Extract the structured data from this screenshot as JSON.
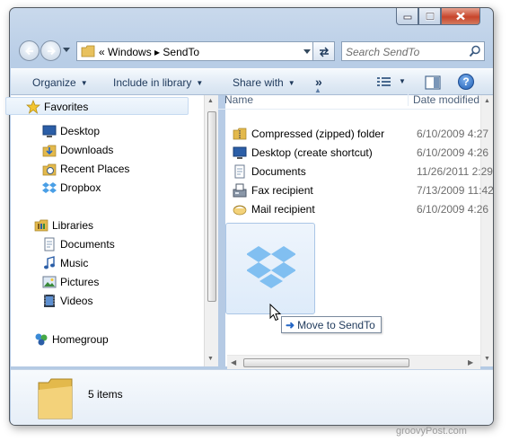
{
  "window": {
    "controls": {
      "minimize": "minimize-icon",
      "maximize": "maximize-icon",
      "close": "close-icon"
    }
  },
  "address_bar": {
    "back_icon": "back-arrow-icon",
    "forward_icon": "forward-arrow-icon",
    "chevrons": "«",
    "crumbs": "Windows ▸ SendTo",
    "refresh_icon": "refresh-icon"
  },
  "search": {
    "placeholder": "Search SendTo",
    "icon": "search-icon"
  },
  "toolbar": {
    "organize": "Organize",
    "include": "Include in library",
    "share": "Share with",
    "more": "»",
    "help": "?"
  },
  "nav": {
    "favorites": "Favorites",
    "favorites_items": [
      "Desktop",
      "Downloads",
      "Recent Places",
      "Dropbox"
    ],
    "libraries": "Libraries",
    "libraries_items": [
      "Documents",
      "Music",
      "Pictures",
      "Videos"
    ],
    "homegroup": "Homegroup"
  },
  "columns": {
    "name": "Name",
    "date": "Date modified"
  },
  "files": [
    {
      "name": "Compressed (zipped) folder",
      "date": "6/10/2009 4:27",
      "icon": "zip-folder-icon"
    },
    {
      "name": "Desktop (create shortcut)",
      "date": "6/10/2009 4:26",
      "icon": "desktop-icon"
    },
    {
      "name": "Documents",
      "date": "11/26/2011 2:29",
      "icon": "document-icon"
    },
    {
      "name": "Fax recipient",
      "date": "7/13/2009 11:42",
      "icon": "fax-icon"
    },
    {
      "name": "Mail recipient",
      "date": "6/10/2009 4:26",
      "icon": "mail-icon"
    }
  ],
  "drag": {
    "tooltip": "Move to SendTo",
    "item_icon": "dropbox-icon"
  },
  "status": {
    "count": "5 items"
  },
  "watermark": "groovyPost.com",
  "colors": {
    "accent": "#1e395b",
    "chrome": "#b8cde6",
    "dropbox": "#4a9fe6"
  }
}
